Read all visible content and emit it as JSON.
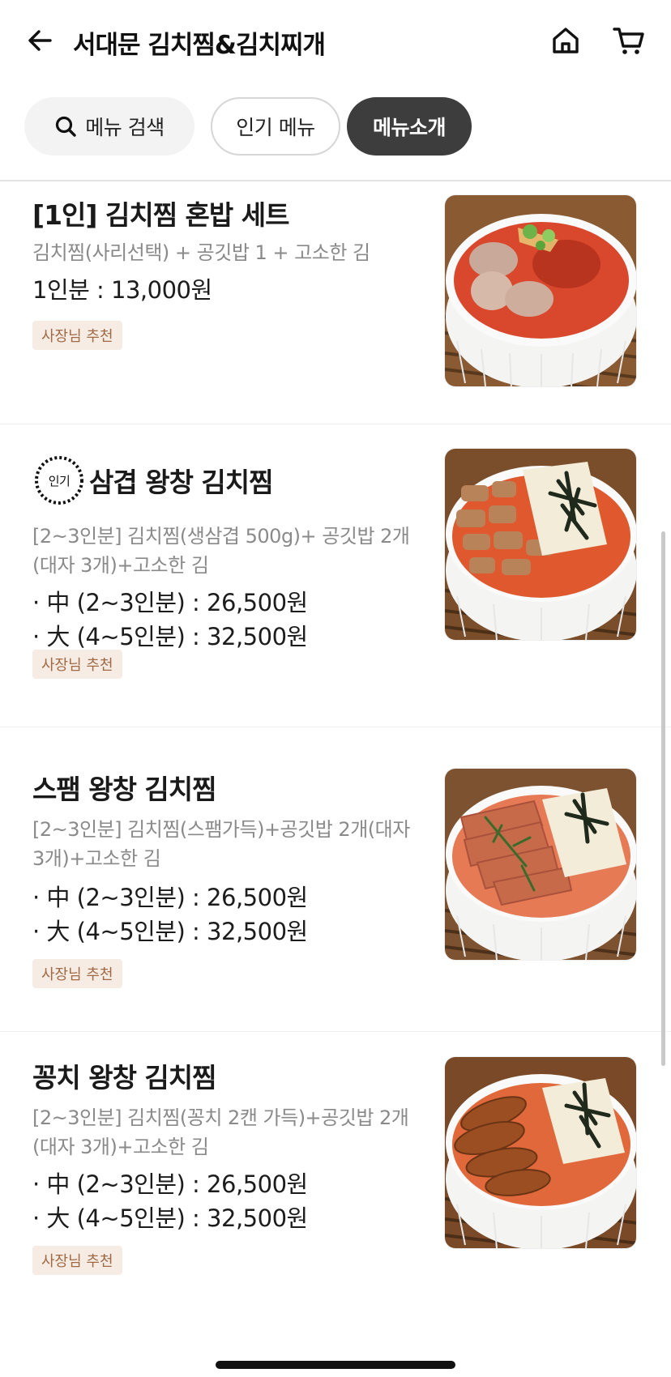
{
  "header": {
    "title": "서대문 김치찜&김치찌개",
    "back_icon": "arrow-left-icon",
    "home_icon": "home-icon",
    "cart_icon": "cart-icon"
  },
  "chips": {
    "search_label": "메뉴 검색",
    "popular_label": "인기 메뉴",
    "intro_label": "메뉴소개"
  },
  "colors": {
    "active_chip_bg": "#3d3d3d",
    "tag_bg": "#f6ece4",
    "tag_text": "#a06a46",
    "desc_text": "#8a8a8a"
  },
  "menu": [
    {
      "name": "[1인] 김치찜 혼밥 세트",
      "popular": false,
      "description": "김치찜(사리선택) + 공깃밥 1 + 고소한 김",
      "prices": [
        "1인분 : 13,000원"
      ],
      "tag": "사장님 추천"
    },
    {
      "name": "삼겹 왕창 김치찜",
      "popular": true,
      "popular_label": "인기",
      "description": "[2~3인분] 김치찜(생삼겹 500g)+ 공깃밥 2개(대자 3개)+고소한 김",
      "prices": [
        "· 中 (2~3인분) : 26,500원",
        "· 大 (4~5인분) : 32,500원"
      ],
      "tag": "사장님 추천"
    },
    {
      "name": "스팸 왕창 김치찜",
      "popular": false,
      "description": "[2~3인분] 김치찜(스팸가득)+공깃밥 2개(대자 3개)+고소한 김",
      "prices": [
        "· 中 (2~3인분) : 26,500원",
        "· 大 (4~5인분) : 32,500원"
      ],
      "tag": "사장님 추천"
    },
    {
      "name": "꽁치 왕창 김치찜",
      "popular": false,
      "description": "[2~3인분] 김치찜(꽁치 2캔 가득)+공깃밥 2개(대자 3개)+고소한 김",
      "prices": [
        "· 中 (2~3인분) : 26,500원",
        "· 大 (4~5인분) : 32,500원"
      ],
      "tag": "사장님 추천"
    }
  ]
}
